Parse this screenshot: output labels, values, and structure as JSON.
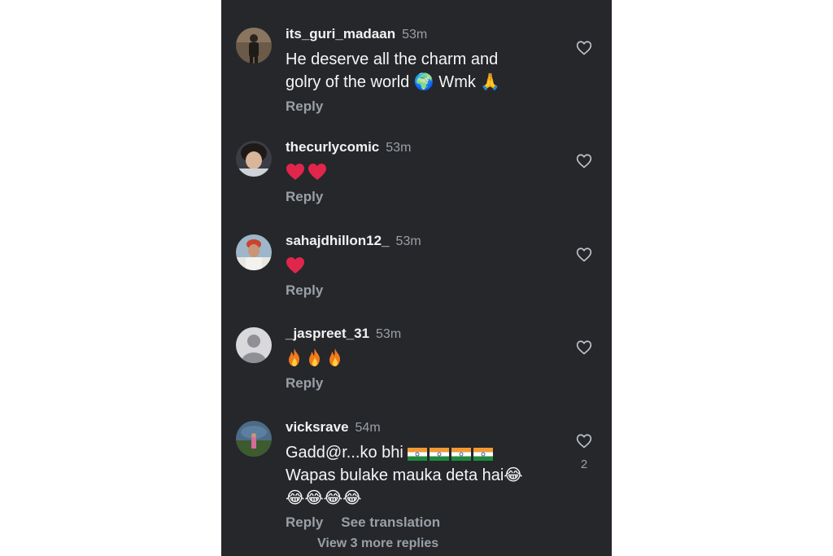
{
  "colors": {
    "background": "#25272b",
    "text_primary": "#f5f5f5",
    "text_secondary": "#9aa0a6",
    "heart": "#e0264a"
  },
  "comments": [
    {
      "username": "its_guri_madaan",
      "time": "53m",
      "lines": [
        "He deserve all the charm and",
        "golry of the world 🌍 Wmk 🙏"
      ],
      "reply_label": "Reply"
    },
    {
      "username": "thecurlycomic",
      "time": "53m",
      "emoji_icons": [
        "heart-icon",
        "heart-icon"
      ],
      "reply_label": "Reply"
    },
    {
      "username": "sahajdhillon12_",
      "time": "53m",
      "emoji_icons": [
        "heart-icon"
      ],
      "reply_label": "Reply"
    },
    {
      "username": "_jaspreet_31",
      "time": "53m",
      "emoji_icons": [
        "fire-icon",
        "fire-icon",
        "fire-icon"
      ],
      "reply_label": "Reply"
    },
    {
      "username": "vicksrave",
      "time": "54m",
      "line1": "Gadd@r...ko bhi",
      "line1_emoji_icons": [
        "india-flag-icon",
        "india-flag-icon",
        "india-flag-icon",
        "india-flag-icon"
      ],
      "line2": "Wapas bulake mauka deta hai😂",
      "line3_emoji": "😂😂😂😂",
      "reply_label": "Reply",
      "see_translation_label": "See translation",
      "like_count": "2"
    }
  ],
  "view_more_replies": "View 3 more replies"
}
